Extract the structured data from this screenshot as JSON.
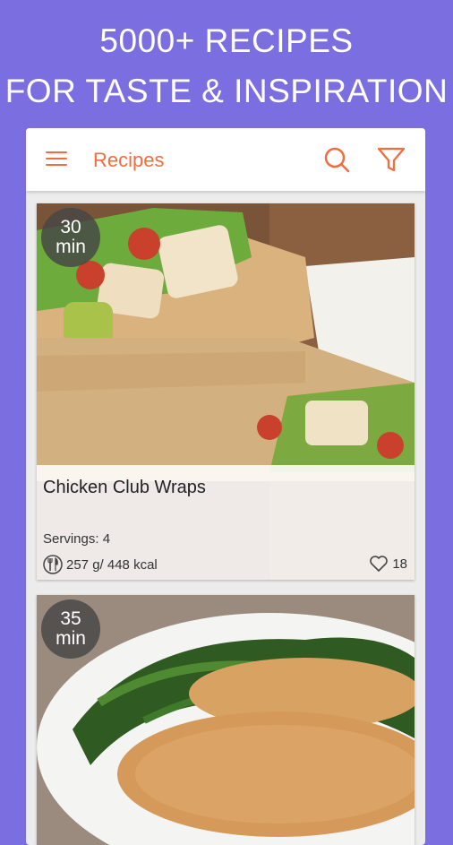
{
  "promo": {
    "line1": "5000+ RECIPES",
    "line2": "FOR TASTE & INSPIRATION"
  },
  "appbar": {
    "title": "Recipes",
    "icons": [
      "menu-icon",
      "search-icon",
      "filter-icon"
    ]
  },
  "recipes": [
    {
      "time_value": "30",
      "time_unit": "min",
      "name": "Chicken Club Wraps",
      "servings": "Servings: 4",
      "nutrition": "257 g/ 448 kcal",
      "likes": "18"
    },
    {
      "time_value": "35",
      "time_unit": "min"
    }
  ],
  "colors": {
    "background": "#7b6ee0",
    "accent": "#f26d3d"
  }
}
